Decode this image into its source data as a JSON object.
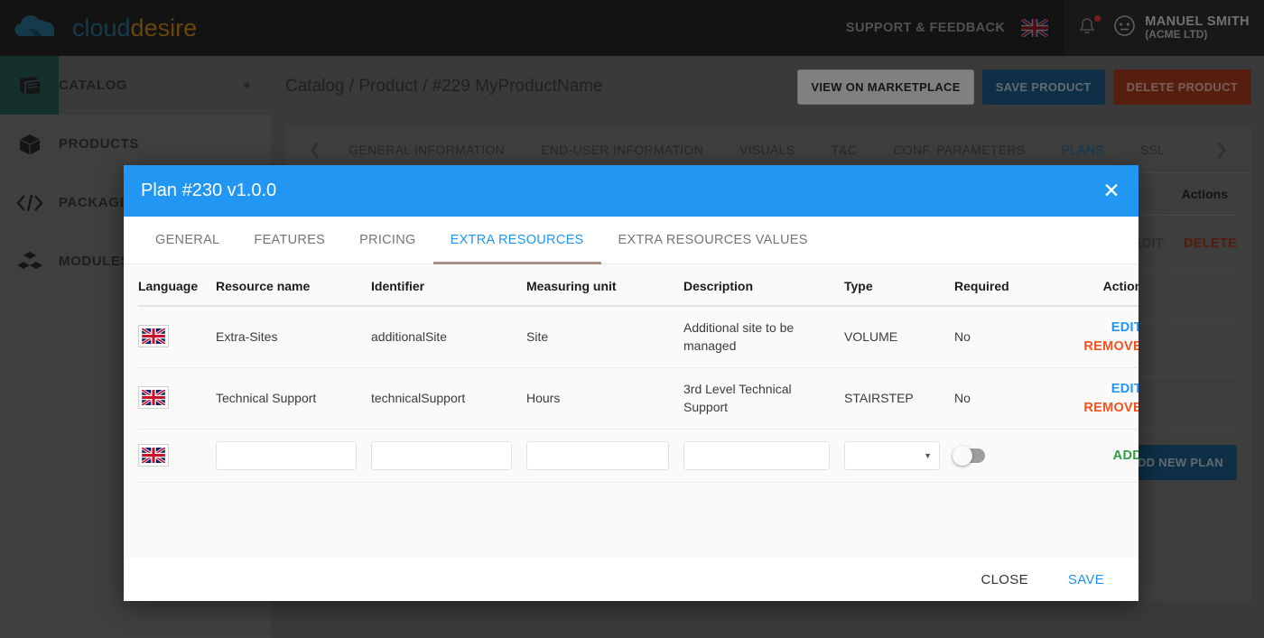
{
  "brand": {
    "logo_part1": "cloud",
    "logo_part2": "desire",
    "logo_color1": "#2d6f8e",
    "logo_color2": "#c8851b",
    "cloud_icon": "cloud-icon"
  },
  "topbar": {
    "support_label": "SUPPORT & FEEDBACK",
    "language_flag": "uk-flag-icon",
    "notifications_icon": "bell-icon",
    "notifications_badge": true,
    "avatar_icon": "user-avatar-icon",
    "user_name": "MANUEL SMITH",
    "user_org": "(ACME LTD)"
  },
  "sidebar": {
    "collapse_icon": "chevron-left-icon",
    "items": [
      {
        "label": "CATALOG",
        "icon": "book-icon",
        "active": true
      },
      {
        "label": "PRODUCTS",
        "icon": "cube-icon",
        "active": false
      },
      {
        "label": "PACKAGES",
        "icon": "code-brackets-icon",
        "active": false
      },
      {
        "label": "MODULES",
        "icon": "boxes-icon",
        "active": false
      }
    ]
  },
  "page": {
    "breadcrumb": "Catalog / Product / #229 MyProductName",
    "buttons": {
      "view_marketplace": "VIEW ON MARKETPLACE",
      "save_product": "SAVE PRODUCT",
      "delete_product": "DELETE PRODUCT"
    },
    "tabs": {
      "prev_icon": "chevron-left-icon",
      "next_icon": "chevron-right-icon",
      "items": [
        {
          "label": "GENERAL INFORMATION",
          "active": false
        },
        {
          "label": "END-USER INFORMATION",
          "active": false
        },
        {
          "label": "VISUALS",
          "active": false
        },
        {
          "label": "T&C",
          "active": false
        },
        {
          "label": "CONF. PARAMETERS",
          "active": false
        },
        {
          "label": "PLANS",
          "active": true
        },
        {
          "label": "SSL",
          "active": false
        }
      ]
    },
    "plans_table": {
      "actions_header": "Actions",
      "row_actions": {
        "edit": "EDIT",
        "delete": "DELETE"
      },
      "add_new_plan": "ADD NEW PLAN"
    }
  },
  "modal": {
    "title": "Plan #230 v1.0.0",
    "close_icon": "close-icon",
    "tabs": [
      {
        "label": "GENERAL",
        "active": false
      },
      {
        "label": "FEATURES",
        "active": false
      },
      {
        "label": "PRICING",
        "active": false
      },
      {
        "label": "EXTRA RESOURCES",
        "active": true
      },
      {
        "label": "EXTRA RESOURCES VALUES",
        "active": false
      }
    ],
    "table": {
      "headers": [
        "Language",
        "Resource name",
        "Identifier",
        "Measuring unit",
        "Description",
        "Type",
        "Required",
        "Actions"
      ],
      "rows": [
        {
          "language_flag": "uk-flag-icon",
          "resource_name": "Extra-Sites",
          "identifier": "additionalSite",
          "measuring_unit": "Site",
          "description": "Additional site to be managed",
          "type": "VOLUME",
          "required": "No",
          "actions": {
            "edit": "EDIT",
            "remove": "REMOVE"
          }
        },
        {
          "language_flag": "uk-flag-icon",
          "resource_name": "Technical Support",
          "identifier": "technicalSupport",
          "measuring_unit": "Hours",
          "description": "3rd Level Technical Support",
          "type": "STAIRSTEP",
          "required": "No",
          "actions": {
            "edit": "EDIT",
            "remove": "REMOVE"
          }
        }
      ],
      "new_row": {
        "language_flag": "uk-flag-icon",
        "resource_name_value": "",
        "resource_name_placeholder": "",
        "identifier_value": "",
        "identifier_placeholder": "",
        "measuring_unit_value": "",
        "measuring_unit_placeholder": "",
        "description_value": "",
        "description_placeholder": "",
        "type_selected": "",
        "type_caret_icon": "chevron-down-icon",
        "required_toggle_on": false,
        "add_label": "ADD"
      }
    },
    "footer": {
      "close_label": "CLOSE",
      "save_label": "SAVE"
    }
  },
  "colors": {
    "accent_blue": "#2196f3",
    "remove_orange": "#f4511e",
    "add_green": "#2e9e45",
    "header_dark": "#252525",
    "sidebar_active_teal": "#2a5a55",
    "tab_underline": "#a98f84"
  }
}
